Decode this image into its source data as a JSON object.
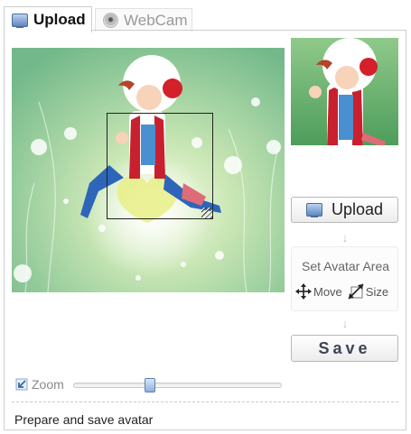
{
  "tabs": [
    {
      "label": "Upload",
      "icon": "monitor-icon",
      "active": true
    },
    {
      "label": "WebCam",
      "icon": "webcam-icon",
      "active": false
    }
  ],
  "sidebar": {
    "upload_label": "Upload",
    "set_area_title": "Set Avatar Area",
    "move_label": "Move",
    "size_label": "Size",
    "save_label": "Save"
  },
  "zoom": {
    "label": "Zoom",
    "level": 0.37
  },
  "status": {
    "text": "Prepare and save avatar"
  },
  "colors": {
    "accent": "#5f82b0",
    "image_bg": "#8fc98a",
    "border": "#cfcfcf"
  }
}
